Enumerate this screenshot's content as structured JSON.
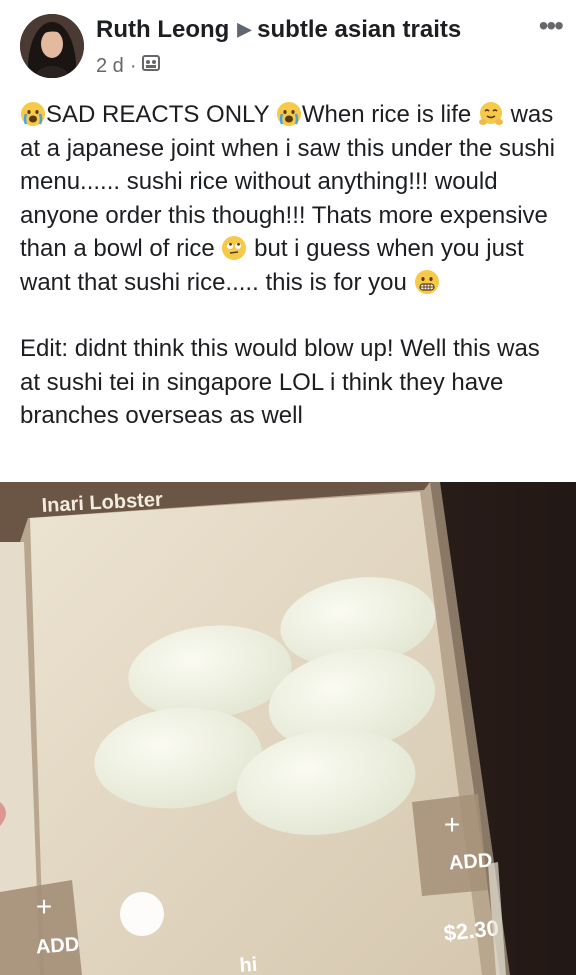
{
  "post": {
    "author": "Ruth Leong",
    "group": "subtle asian traits",
    "time": "2 d",
    "text": {
      "line1_a": "SAD REACTS ONLY ",
      "line1_b": "When rice is life",
      "body1": "was at a japanese joint when i saw this under the sushi menu...... sushi rice without anything!!! would anyone order this though!!! Thats more expensive than a bowl of rice",
      "body2": "but i guess when you just want that sushi rice..... this is for you",
      "edit": "Edit: didnt think this would blow up! Well this was at sushi tei in singapore LOL i think they have branches overseas as well"
    },
    "icons": [
      "avatar",
      "triangle-arrow-icon",
      "privacy-group-icon",
      "more-options-icon",
      "crying-face-icon",
      "hugging-face-icon",
      "rolling-eyes-icon",
      "grimacing-face-icon"
    ]
  },
  "photo": {
    "top_label": "Inari Lobster",
    "add_label": "ADD",
    "add_symbol": "+",
    "price": "$2.30",
    "bottom_text": "hi"
  }
}
